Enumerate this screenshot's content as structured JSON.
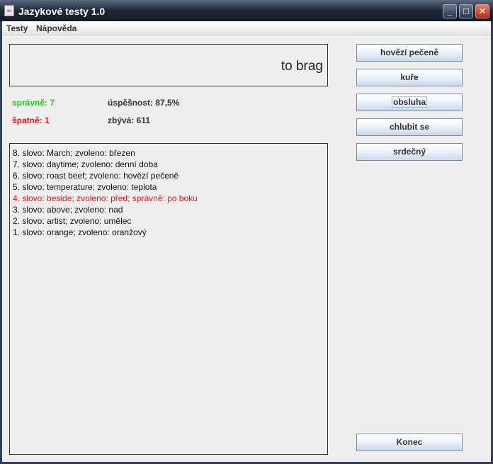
{
  "window": {
    "title": "Jazykové testy 1.0"
  },
  "menu": [
    "Testy",
    "Nápověda"
  ],
  "word": "to brag",
  "stats": {
    "correct": "správně: 7",
    "wrong": "špatně: 1",
    "success": "úspěšnost: 87,5%",
    "remaining": "zbývá: 611"
  },
  "history": [
    {
      "text": "8. slovo: March;  zvoleno: březen",
      "error": false
    },
    {
      "text": "7. slovo: daytime;  zvoleno: denní doba",
      "error": false
    },
    {
      "text": "6. slovo: roast beef;  zvoleno: hovězí pečeně",
      "error": false
    },
    {
      "text": "5. slovo: temperature;  zvoleno: teplota",
      "error": false
    },
    {
      "text": "4. slovo: beside;  zvoleno: před; správně: po boku",
      "error": true
    },
    {
      "text": "3. slovo: above;  zvoleno: nad",
      "error": false
    },
    {
      "text": "2. slovo: artist;  zvoleno: umělec",
      "error": false
    },
    {
      "text": "1. slovo: orange;  zvoleno: oranžový",
      "error": false
    }
  ],
  "options": [
    "hovězí pečeně",
    "kuře",
    "obsluha",
    "chlubit se",
    "srdečný"
  ],
  "end_button": "Konec",
  "colors": {
    "correct": "#22cc22",
    "wrong": "#ff1010"
  }
}
